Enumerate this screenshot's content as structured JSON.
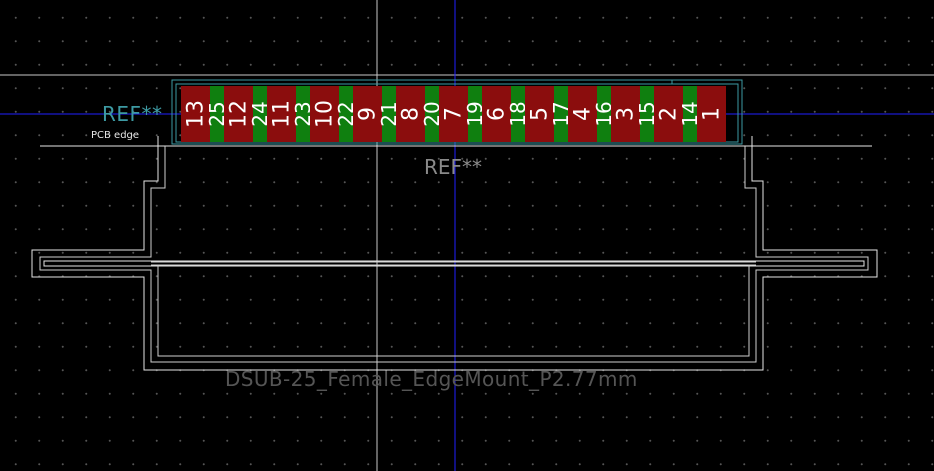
{
  "canvas": {
    "background": "#000000",
    "grid_dot_color": "#555555",
    "crosshair_color": "#c8c8c8",
    "axis_color": "#1f1fff"
  },
  "colors": {
    "pad_front": "#8b0d0d",
    "pad_back": "#0f7f0f",
    "silkscreen": "#e6e6e6",
    "courtyard": "#3d9aa3"
  },
  "labels": {
    "ref_silkscreen": "REF**",
    "ref_fab": "REF**",
    "pcb_edge": "PCB edge",
    "footprint_value": "DSUB-25_Female_EdgeMount_P2.77mm"
  },
  "pads": [
    {
      "number": "13",
      "layer": "front"
    },
    {
      "number": "25",
      "layer": "back"
    },
    {
      "number": "12",
      "layer": "front"
    },
    {
      "number": "24",
      "layer": "back"
    },
    {
      "number": "11",
      "layer": "front"
    },
    {
      "number": "23",
      "layer": "back"
    },
    {
      "number": "10",
      "layer": "front"
    },
    {
      "number": "22",
      "layer": "back"
    },
    {
      "number": "9",
      "layer": "front"
    },
    {
      "number": "21",
      "layer": "back"
    },
    {
      "number": "8",
      "layer": "front"
    },
    {
      "number": "20",
      "layer": "back"
    },
    {
      "number": "7",
      "layer": "front"
    },
    {
      "number": "19",
      "layer": "back"
    },
    {
      "number": "6",
      "layer": "front"
    },
    {
      "number": "18",
      "layer": "back"
    },
    {
      "number": "5",
      "layer": "front"
    },
    {
      "number": "17",
      "layer": "back"
    },
    {
      "number": "4",
      "layer": "front"
    },
    {
      "number": "16",
      "layer": "back"
    },
    {
      "number": "3",
      "layer": "front"
    },
    {
      "number": "15",
      "layer": "back"
    },
    {
      "number": "2",
      "layer": "front"
    },
    {
      "number": "14",
      "layer": "back"
    },
    {
      "number": "1",
      "layer": "front"
    }
  ]
}
